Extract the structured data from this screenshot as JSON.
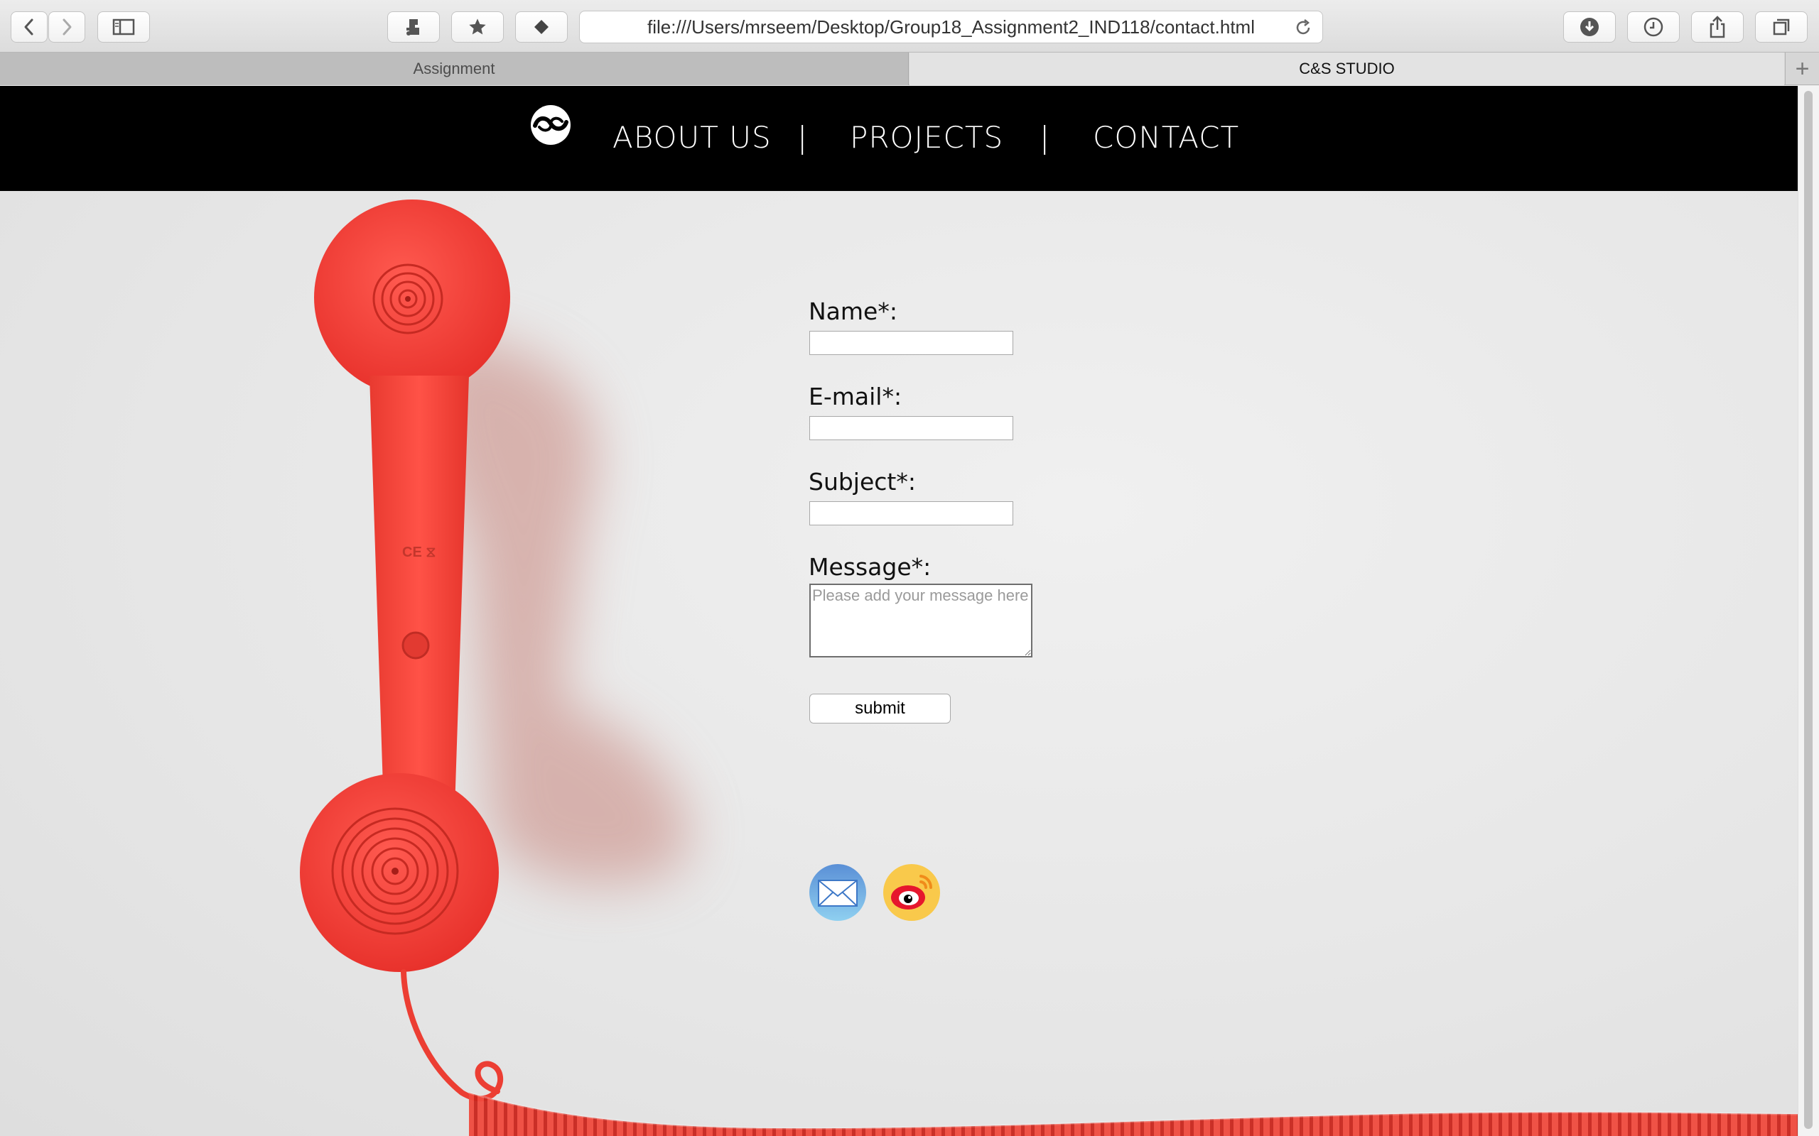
{
  "browser": {
    "url": "file:///Users/mrseem/Desktop/Group18_Assignment2_IND118/contact.html",
    "tabs": [
      {
        "label": "Assignment",
        "active": false
      },
      {
        "label": "C&S STUDIO",
        "active": true
      }
    ],
    "new_tab_label": "+",
    "icons": [
      "back-icon",
      "forward-icon",
      "sidebar-icon",
      "extension-icon",
      "bookmark-star-icon",
      "diamond-icon",
      "reload-icon",
      "download-icon",
      "history-icon",
      "share-icon",
      "tabs-overview-icon"
    ]
  },
  "nav": {
    "logo_icon": "cs-studio-logo",
    "items": [
      {
        "label": "ABOUT US"
      },
      {
        "label": "PROJECTS"
      },
      {
        "label": "CONTACT"
      }
    ],
    "separator": "|"
  },
  "form": {
    "name_label": "Name*:",
    "email_label": "E-mail*:",
    "subject_label": "Subject*:",
    "message_label": "Message*:",
    "message_placeholder": "Please add your message here",
    "submit_label": "submit"
  },
  "social": [
    "email-icon",
    "weibo-icon"
  ],
  "colors": {
    "nav_background": "#000000",
    "phone_red": "#f23b3b"
  }
}
